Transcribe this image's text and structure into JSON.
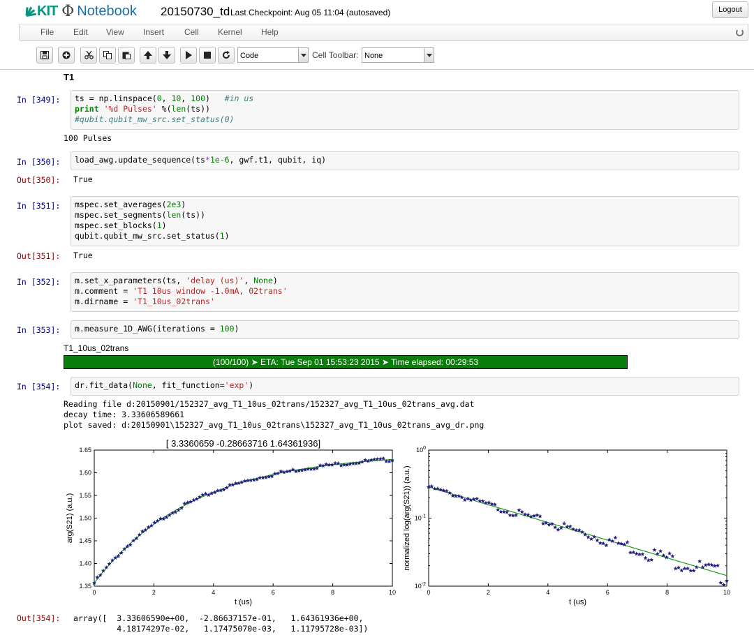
{
  "app": {
    "logo_kit": "KIT",
    "logo_phi": "Φ",
    "logo_notebook": "Notebook",
    "notebook_name": "20150730_td",
    "checkpoint": "Last Checkpoint: Aug 05 11:04 (autosaved)",
    "logout": "Logout"
  },
  "menu": [
    "File",
    "Edit",
    "View",
    "Insert",
    "Cell",
    "Kernel",
    "Help"
  ],
  "toolbar": {
    "buttons": [
      "save-icon",
      "add-cell-icon",
      "cut-icon",
      "copy-icon",
      "paste-icon",
      "move-up-icon",
      "move-down-icon",
      "run-icon",
      "stop-icon",
      "restart-icon"
    ],
    "cell_type": "Code",
    "cell_toolbar_label": "Cell Toolbar:",
    "cell_toolbar_value": "None"
  },
  "cells": {
    "heading": "T1",
    "c349": {
      "prompt": "In [349]:",
      "output": "100 Pulses"
    },
    "c350": {
      "prompt": "In [350]:",
      "out_prompt": "Out[350]:",
      "output": "True"
    },
    "c351": {
      "prompt": "In [351]:",
      "out_prompt": "Out[351]:",
      "output": "True"
    },
    "c352": {
      "prompt": "In [352]:"
    },
    "c353": {
      "prompt": "In [353]:",
      "output_name": "T1_10us_02trans",
      "progress": "(100/100) ➤ ETA: Tue Sep 01 15:53:23 2015 ➤ Time elapsed: 00:29:53",
      "progress_fraction": 1.0
    },
    "c354": {
      "prompt": "In [354]:",
      "out_prompt": "Out[354]:",
      "out_lines": [
        "Reading file d:20150901/152327_avg_T1_10us_02trans/152327_avg_T1_10us_02trans_avg.dat",
        "decay time: 3.33606589661",
        "plot saved: d:20150901\\152327_avg_T1_10us_02trans\\152327_avg_T1_10us_02trans_avg_dr.png"
      ],
      "array_lines": [
        "array([  3.33606590e+00,  -2.86637157e-01,   1.64361936e+00,",
        "         4.18174297e-02,   1.17475070e-03,   1.11795728e-03])"
      ]
    }
  },
  "colors": {
    "markers": "#1f1f7a",
    "fit_line": "#1a9c1a",
    "progress": "#0a7d0a"
  },
  "chart_data": [
    {
      "type": "scatter",
      "title": "[ 3.3360659  -0.28663716  1.64361936]",
      "xlabel": "t (us)",
      "ylabel": "arg(S21) (a.u.)",
      "xlim": [
        0,
        10
      ],
      "ylim": [
        1.35,
        1.65
      ],
      "xticks": [
        "0",
        "2",
        "4",
        "6",
        "8",
        "10"
      ],
      "yticks": [
        "1.35",
        "1.40",
        "1.45",
        "1.50",
        "1.55",
        "1.60",
        "1.65"
      ],
      "series": [
        {
          "marker": "star",
          "x_range": [
            0,
            10
          ],
          "n_points": 100,
          "model": "1.64362 - 0.28664*exp(-t/3.33607)"
        },
        {
          "line": "fit",
          "model": "1.64362 - 0.28664*exp(-t/3.33607)"
        }
      ]
    },
    {
      "type": "scatter",
      "scale_y": "log",
      "xlabel": "t (us)",
      "ylabel": "normalized log(arg(S21)) (a.u.)",
      "xlim": [
        0,
        10
      ],
      "ylim": [
        0.01,
        1
      ],
      "xticks": [
        "0",
        "2",
        "4",
        "6",
        "8",
        "10"
      ],
      "yticks": [
        "10^-2",
        "10^-1",
        "10^0"
      ],
      "series": [
        {
          "marker": "star",
          "x_range": [
            0,
            10
          ],
          "n_points": 100,
          "model": "0.28664*exp(-t/3.33607)"
        },
        {
          "line": "fit",
          "model": "0.28664*exp(-t/3.33607)"
        }
      ]
    }
  ]
}
